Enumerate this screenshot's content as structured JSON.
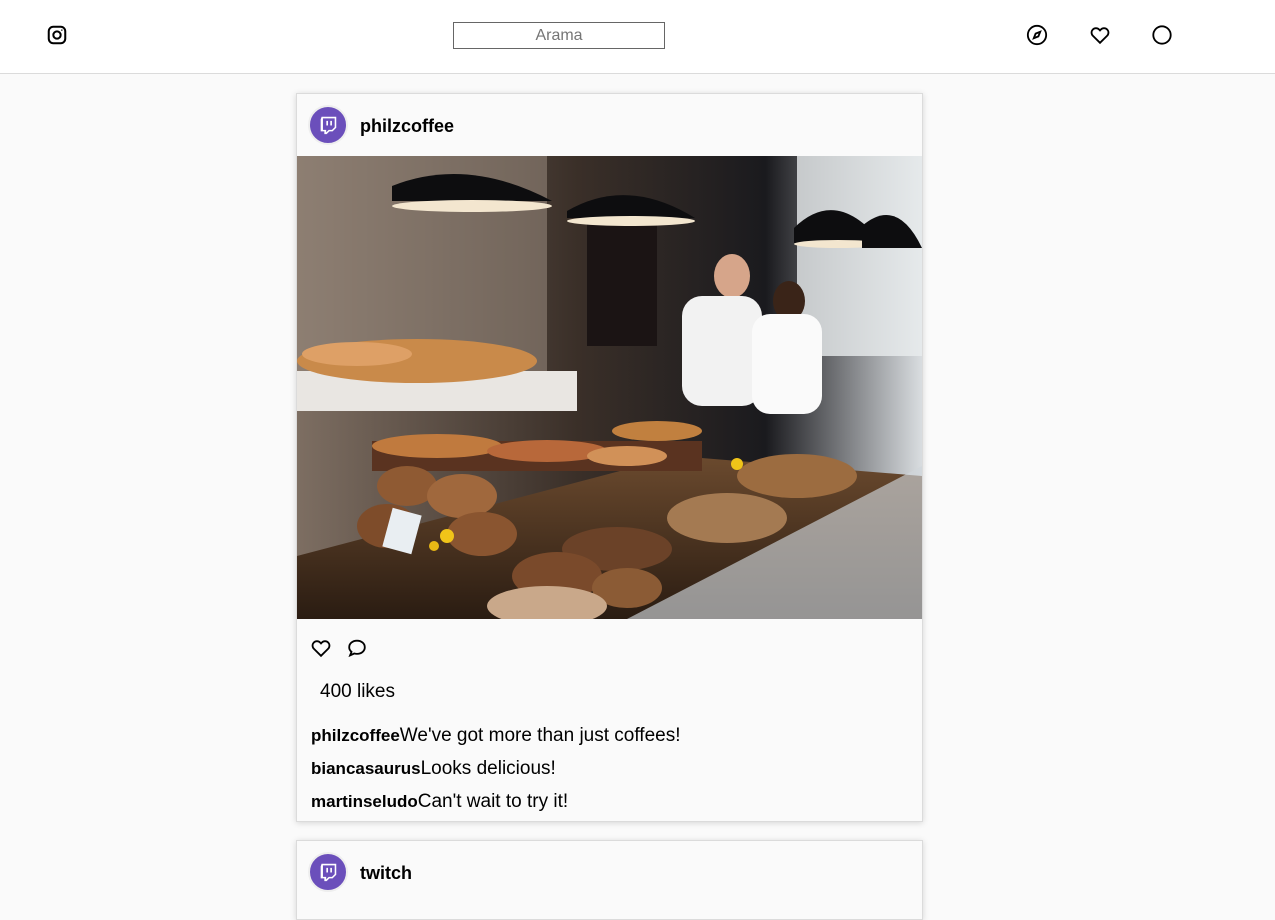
{
  "topbar": {
    "logo_icon": "instagram-icon",
    "search_placeholder": "Arama",
    "nav_icons": [
      "compass-icon",
      "heart-icon",
      "circle-icon"
    ]
  },
  "posts": [
    {
      "username": "philzcoffee",
      "avatar_icon": "twitch-icon",
      "image_alt": "bakery counter",
      "likes": "400 likes",
      "comments": [
        {
          "user": "philzcoffee",
          "text": "We've got more than just coffees!"
        },
        {
          "user": "biancasaurus",
          "text": "Looks delicious!"
        },
        {
          "user": "martinseludo",
          "text": "Can't wait to try it!"
        }
      ]
    },
    {
      "username": "twitch",
      "avatar_icon": "twitch-icon"
    }
  ],
  "colors": {
    "avatar_bg": "#6b4fbb",
    "border": "#dbdbdb",
    "page_bg": "#fafafa"
  }
}
